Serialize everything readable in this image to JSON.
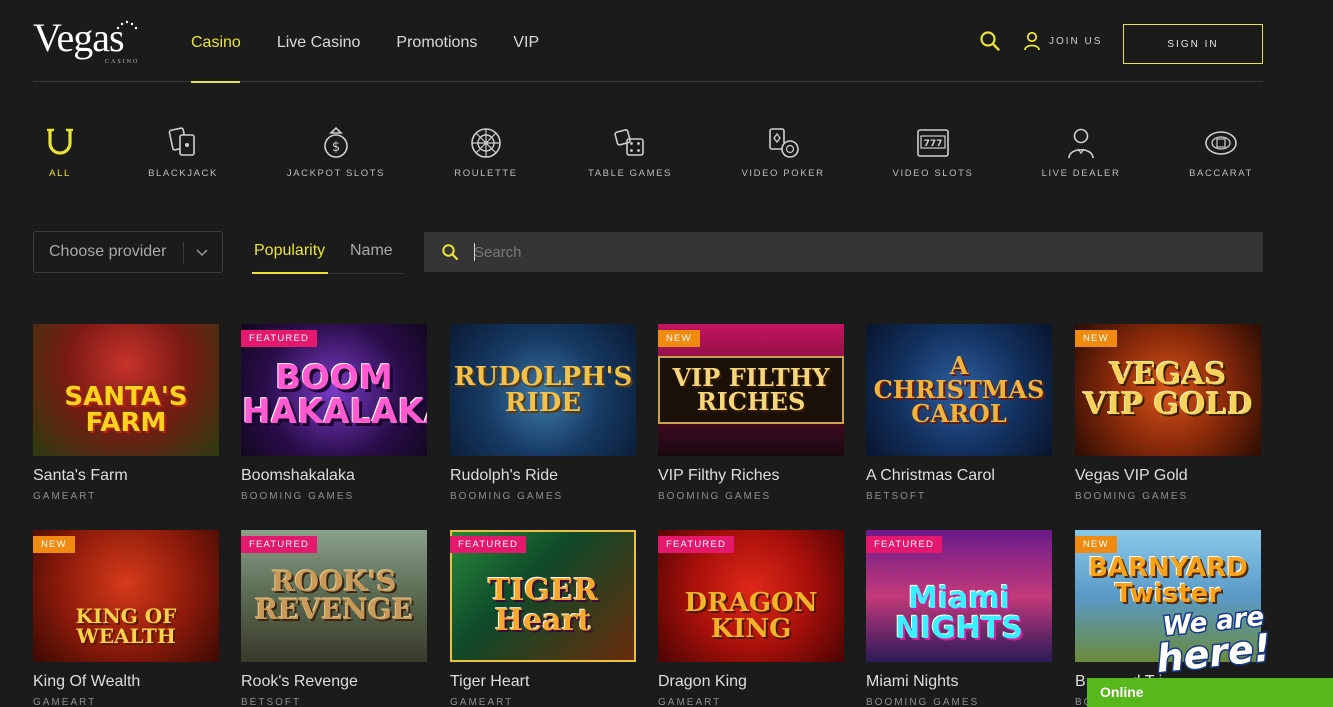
{
  "brand": {
    "logo_text": "Vegas",
    "logo_sub": "CASINO"
  },
  "nav": [
    {
      "label": "Casino",
      "active": true
    },
    {
      "label": "Live Casino"
    },
    {
      "label": "Promotions"
    },
    {
      "label": "VIP"
    }
  ],
  "header": {
    "join_label": "JOIN US",
    "signin_label": "SIGN IN"
  },
  "categories": [
    {
      "label": "ALL",
      "icon": "horseshoe-icon",
      "active": true
    },
    {
      "label": "BLACKJACK",
      "icon": "cards-icon"
    },
    {
      "label": "JACKPOT SLOTS",
      "icon": "money-bag-icon"
    },
    {
      "label": "ROULETTE",
      "icon": "roulette-wheel-icon"
    },
    {
      "label": "TABLE GAMES",
      "icon": "dice-icon"
    },
    {
      "label": "VIDEO POKER",
      "icon": "poker-cards-chip-icon"
    },
    {
      "label": "VIDEO SLOTS",
      "icon": "slot-machine-icon"
    },
    {
      "label": "LIVE DEALER",
      "icon": "dealer-icon"
    },
    {
      "label": "BACCARAT",
      "icon": "baccarat-icon"
    }
  ],
  "filters": {
    "provider_label": "Choose provider",
    "sort_popularity": "Popularity",
    "sort_name": "Name",
    "search_placeholder": "Search"
  },
  "games": [
    {
      "name": "Santa's Farm",
      "provider": "GAMEART",
      "badge": "",
      "art": "SANTA'S FARM"
    },
    {
      "name": "Boomshakalaka",
      "provider": "BOOMING GAMES",
      "badge": "FEATURED",
      "art": "BOOM SHAKALAKA"
    },
    {
      "name": "Rudolph's Ride",
      "provider": "BOOMING GAMES",
      "badge": "",
      "art": "RUDOLPH'S RIDE"
    },
    {
      "name": "VIP Filthy Riches",
      "provider": "BOOMING GAMES",
      "badge": "NEW",
      "art": "VIP FILTHY RICHES"
    },
    {
      "name": "A Christmas Carol",
      "provider": "BETSOFT",
      "badge": "",
      "art": "A CHRISTMAS CAROL"
    },
    {
      "name": "Vegas VIP Gold",
      "provider": "BOOMING GAMES",
      "badge": "NEW",
      "art": "VEGAS VIP GOLD"
    },
    {
      "name": "King Of Wealth",
      "provider": "GAMEART",
      "badge": "NEW",
      "art": "KING OF WEALTH"
    },
    {
      "name": "Rook's Revenge",
      "provider": "BETSOFT",
      "badge": "FEATURED",
      "art": "ROOK'S REVENGE"
    },
    {
      "name": "Tiger Heart",
      "provider": "GAMEART",
      "badge": "FEATURED",
      "art": "TIGER Heart"
    },
    {
      "name": "Dragon King",
      "provider": "GAMEART",
      "badge": "FEATURED",
      "art": "DRAGON KING"
    },
    {
      "name": "Miami Nights",
      "provider": "BOOMING GAMES",
      "badge": "FEATURED",
      "art": "Miami NIGHTS"
    },
    {
      "name": "Barnyard Twister",
      "provider": "BO",
      "badge": "NEW",
      "art": "BARNYARD Twister",
      "name_visible": "B",
      "name_tail": "d T i"
    }
  ],
  "chat": {
    "bubble_text": "We are here!",
    "status_label": "Online"
  },
  "colors": {
    "accent": "#e8e337",
    "background": "#1b1b1b",
    "featured": "#e4186d",
    "new": "#f08a10",
    "chat_green": "#58b71b"
  }
}
